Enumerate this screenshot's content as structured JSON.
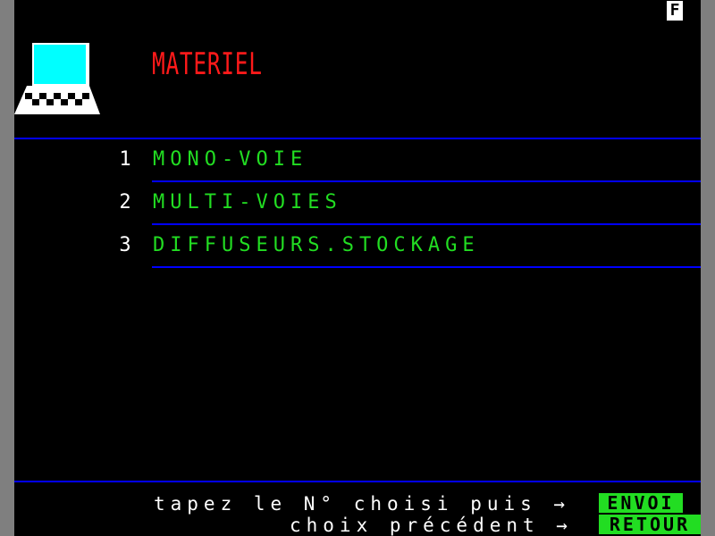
{
  "status": {
    "indicator": "F"
  },
  "header": {
    "title": "MATERIEL",
    "logo_icon": "terminal-icon"
  },
  "menu": {
    "items": [
      {
        "number": "1",
        "label": "MONO-VOIE"
      },
      {
        "number": "2",
        "label": "MULTI-VOIES"
      },
      {
        "number": "3",
        "label": "DIFFUSEURS.STOCKAGE"
      }
    ]
  },
  "footer": {
    "line1": "tapez le N° choisi puis →",
    "line2": "choix précédent →",
    "envoi_label": "ENVOI",
    "retour_label": "RETOUR"
  },
  "colors": {
    "background": "#000000",
    "title": "#ff1a1a",
    "menu_text": "#22dd22",
    "rule": "#0000ff",
    "monitor_screen": "#00ffff"
  }
}
